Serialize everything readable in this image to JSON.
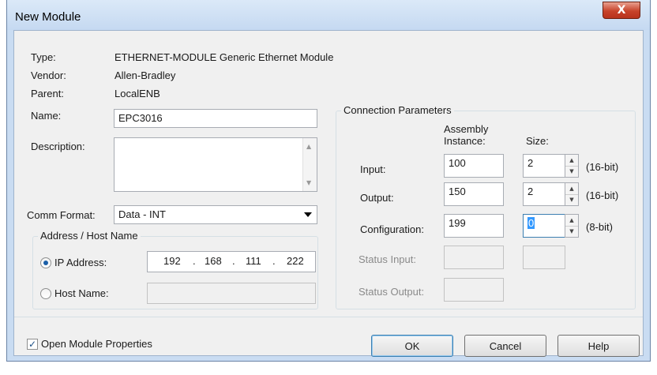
{
  "window": {
    "title": "New Module",
    "close_glyph": "X"
  },
  "info": {
    "type_label": "Type:",
    "type_value": "ETHERNET-MODULE Generic Ethernet Module",
    "vendor_label": "Vendor:",
    "vendor_value": "Allen-Bradley",
    "parent_label": "Parent:",
    "parent_value": "LocalENB"
  },
  "name_field": {
    "label": "Name:",
    "value": "EPC3016"
  },
  "description_field": {
    "label": "Description:",
    "value": ""
  },
  "comm_format": {
    "label": "Comm Format:",
    "value": "Data - INT"
  },
  "address": {
    "group_title": "Address / Host Name",
    "ip_label": "IP Address:",
    "ip_selected": true,
    "ip_octets": [
      "192",
      "168",
      "111",
      "222"
    ],
    "ip_dot": ".",
    "host_label": "Host Name:",
    "host_value": ""
  },
  "connection": {
    "group_title": "Connection Parameters",
    "col_assembly_line1": "Assembly",
    "col_assembly_line2": "Instance:",
    "col_size": "Size:",
    "rows": [
      {
        "label": "Input:",
        "instance": "100",
        "size": "2",
        "unit": "(16-bit)"
      },
      {
        "label": "Output:",
        "instance": "150",
        "size": "2",
        "unit": "(16-bit)"
      },
      {
        "label": "Configuration:",
        "instance": "199",
        "size": "0",
        "unit": "(8-bit)"
      }
    ],
    "status_input_label": "Status Input:",
    "status_output_label": "Status Output:"
  },
  "footer": {
    "open_props_label": "Open Module Properties",
    "open_props_checked": true,
    "ok_label": "OK",
    "cancel_label": "Cancel",
    "help_label": "Help"
  },
  "icons": {
    "spin_up": "▲",
    "spin_down": "▼",
    "scroll_up": "▲",
    "scroll_down": "▼",
    "check": "✓"
  },
  "colors": {
    "title_bar": "#c5d9f1",
    "dialog_bg": "#f0f0f0",
    "close_button": "#c7432a",
    "selection": "#3399ff"
  }
}
